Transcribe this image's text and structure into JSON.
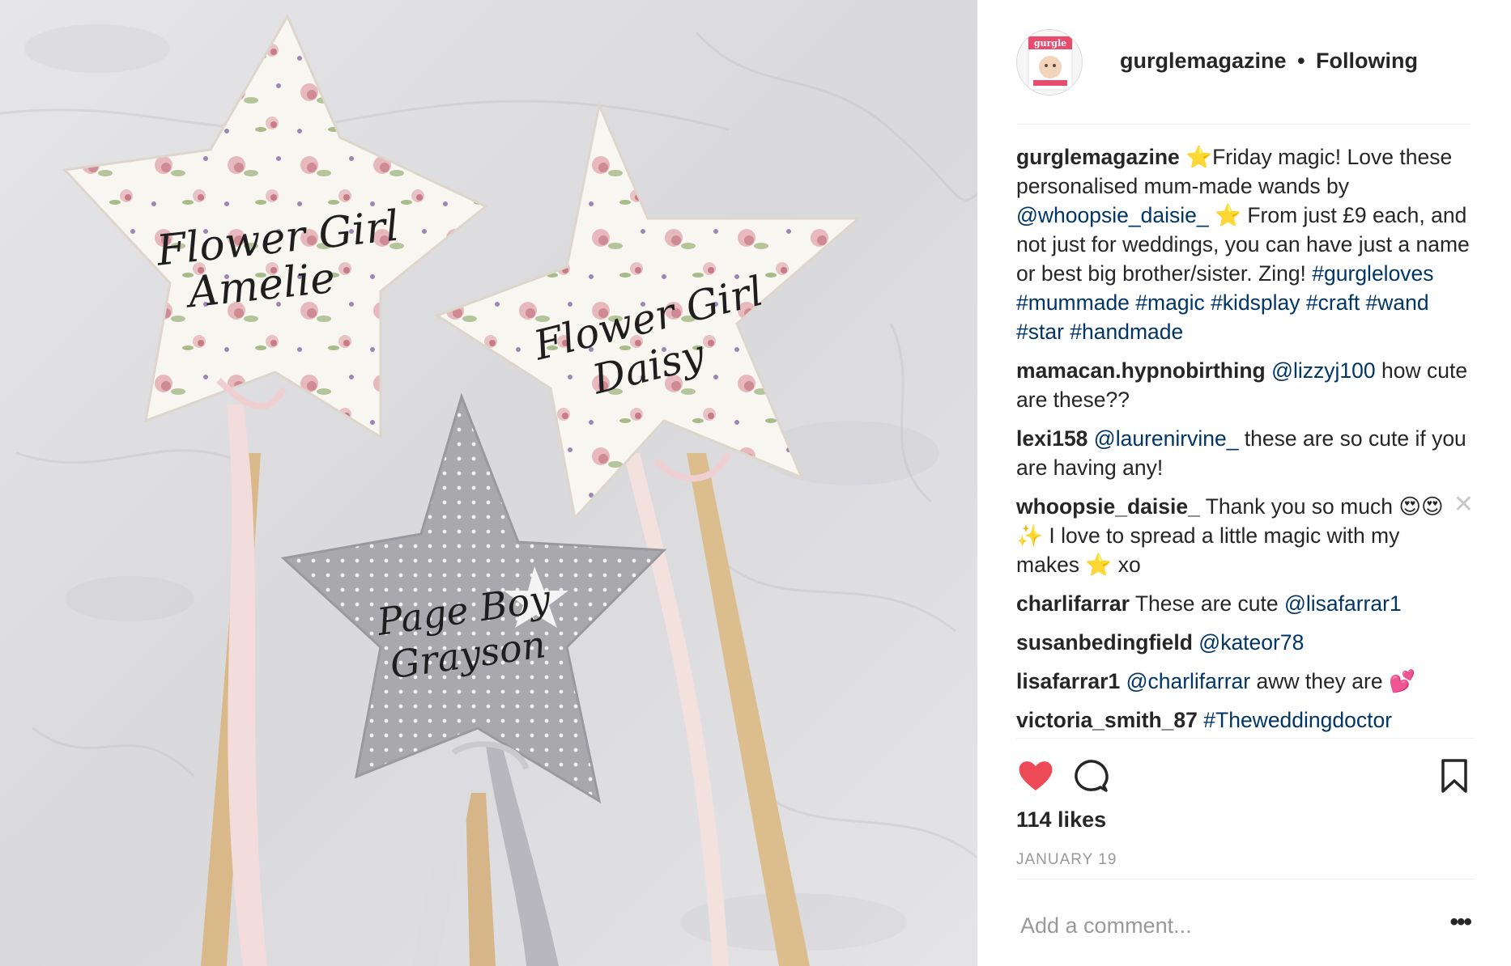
{
  "post": {
    "image_alt": "Three handmade star wands with personalised names",
    "star_labels": [
      {
        "line1": "Flower Girl",
        "line2": "Amelie"
      },
      {
        "line1": "Flower Girl",
        "line2": "Daisy"
      },
      {
        "line1": "Page Boy",
        "line2": "Grayson"
      }
    ]
  },
  "header": {
    "avatar_text": "gurgle",
    "username": "gurglemagazine",
    "separator": "•",
    "follow_status": "Following"
  },
  "caption": {
    "user": "gurglemagazine",
    "emoji1": "⭐",
    "text1": "Friday magic! Love these personalised mum-made wands by ",
    "mention": "@whoopsie_daisie_",
    "emoji2": " ⭐ ",
    "text2": "From just £9 each, and not just for weddings, you can have just a name or best big brother/sister. Zing! ",
    "hashtags": "#gurgleloves #mummade #magic #kidsplay #craft #wand #star #handmade"
  },
  "comments": [
    {
      "user": "mamacan.hypnobirthing",
      "mention": "@lizzyj100",
      "text": " how cute are these??"
    },
    {
      "user": "lexi158",
      "mention": "@laurenirvine_",
      "text": " these are so cute if you are having any!"
    },
    {
      "user": "whoopsie_daisie_",
      "mention": "",
      "text": " Thank you so much 😍😍✨ I love to spread a little magic with my makes ⭐ xo",
      "close": "✕"
    },
    {
      "user": "charlifarrar",
      "mention": "",
      "text": " These are cute ",
      "mention_after": "@lisafarrar1"
    },
    {
      "user": "susanbedingfield",
      "mention": "@kateor78",
      "text": ""
    },
    {
      "user": "lisafarrar1",
      "mention": "@charlifarrar",
      "text": " aww they are 💕"
    },
    {
      "user": "victoria_smith_87",
      "mention": "#Theweddingdoctor",
      "text": ""
    }
  ],
  "actions": {
    "like_icon": "heart-icon",
    "comment_icon": "comment-bubble-icon",
    "save_icon": "bookmark-icon",
    "liked": true,
    "like_color": "#ed4956"
  },
  "likes": "114 likes",
  "date": "JANUARY 19",
  "add_comment": {
    "placeholder": "Add a comment...",
    "more": "•••"
  }
}
